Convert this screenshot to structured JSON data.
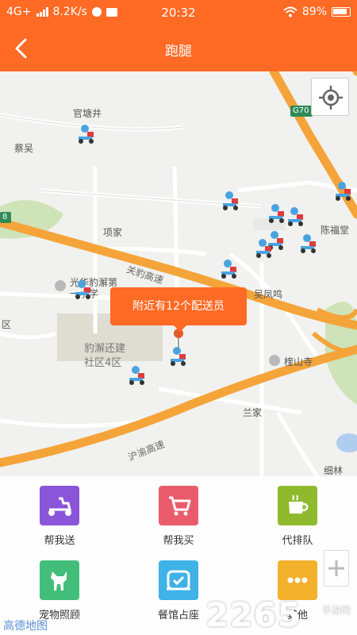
{
  "status_bar": {
    "network": "4G+",
    "speed": "8.2K/s",
    "time": "20:32",
    "battery": "89%"
  },
  "header": {
    "title": "跑腿"
  },
  "map": {
    "labels": {
      "guantangjing": "官塘井",
      "caiwu": "蔡吴",
      "xiangjia": "项家",
      "chenfutang": "陈福堂",
      "guanbao": "关豹高速",
      "wufengming": "吴凤鸣",
      "school": "光华豹澥第一小学",
      "district_short": "区",
      "community_line1": "豹澥还建",
      "community_line2": "社区4区",
      "kuishan": "楏山寺",
      "lanjia": "兰家",
      "huyu": "沪渝高速",
      "xilin": "细林",
      "g70": "G70",
      "route8": "8"
    },
    "tooltip": "附近有12个配送员",
    "courier_count": 12
  },
  "services": [
    {
      "label": "帮我送",
      "icon": "scooter-icon",
      "color": "#8a55d8"
    },
    {
      "label": "帮我买",
      "icon": "cart-icon",
      "color": "#ea5c6b"
    },
    {
      "label": "代排队",
      "icon": "coffee-cup-icon",
      "color": "#8fba2e"
    },
    {
      "label": "宠物照顾",
      "icon": "dog-icon",
      "color": "#43be7a"
    },
    {
      "label": "餐馆占座",
      "icon": "seat-icon",
      "color": "#3fb2e8"
    },
    {
      "label": "其他",
      "icon": "more-icon",
      "color": "#f3b12c"
    }
  ],
  "map_attribution": "高德地图",
  "watermark": {
    "main": "2265",
    "sub": "手游网"
  },
  "colors": {
    "brand": "#ff6a24",
    "highway": "#f5a43a"
  }
}
